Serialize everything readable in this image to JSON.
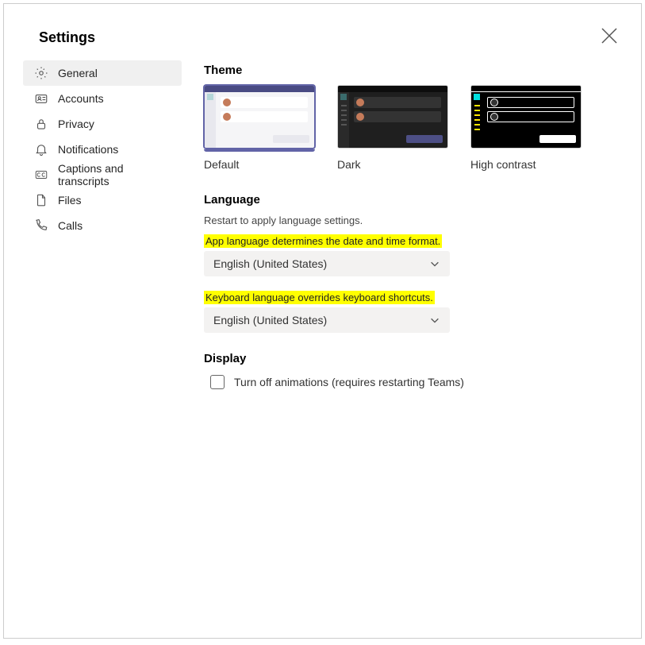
{
  "title": "Settings",
  "sidebar": {
    "items": [
      {
        "id": "general",
        "label": "General",
        "icon": "gear"
      },
      {
        "id": "accounts",
        "label": "Accounts",
        "icon": "id-card"
      },
      {
        "id": "privacy",
        "label": "Privacy",
        "icon": "lock"
      },
      {
        "id": "notifications",
        "label": "Notifications",
        "icon": "bell"
      },
      {
        "id": "captions",
        "label": "Captions and transcripts",
        "icon": "cc"
      },
      {
        "id": "files",
        "label": "Files",
        "icon": "file"
      },
      {
        "id": "calls",
        "label": "Calls",
        "icon": "phone"
      }
    ],
    "active": "general"
  },
  "theme": {
    "heading": "Theme",
    "options": [
      {
        "id": "default",
        "label": "Default"
      },
      {
        "id": "dark",
        "label": "Dark"
      },
      {
        "id": "highcontrast",
        "label": "High contrast"
      }
    ],
    "selected": "default"
  },
  "language": {
    "heading": "Language",
    "restart_note": "Restart to apply language settings.",
    "app_note": "App language determines the date and time format.",
    "app_value": "English (United States)",
    "keyboard_note": "Keyboard language overrides keyboard shortcuts.",
    "keyboard_value": "English (United States)"
  },
  "display": {
    "heading": "Display",
    "animations_label": "Turn off animations (requires restarting Teams)",
    "animations_checked": false
  }
}
